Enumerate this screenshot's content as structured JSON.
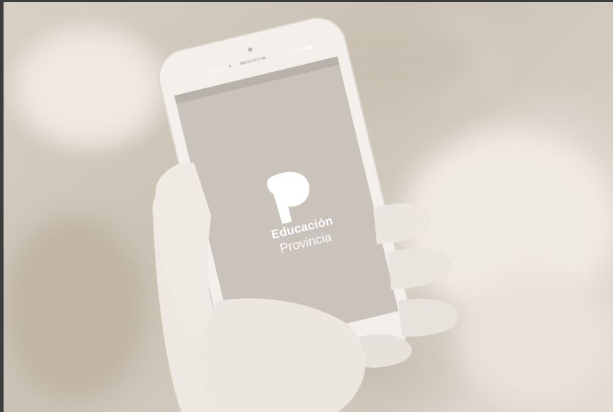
{
  "phone": {
    "status": {
      "carrier": "•••◦◦ Invision ᯤ",
      "time": "9:00 PM",
      "battery": "100%"
    },
    "app": {
      "logo": "p-logo-icon",
      "title": "Educación",
      "subtitle": "Provincia"
    }
  },
  "colors": {
    "screen": "#c8c2bb",
    "phone_body": "#efebe6",
    "background": "#d3cbc0"
  }
}
